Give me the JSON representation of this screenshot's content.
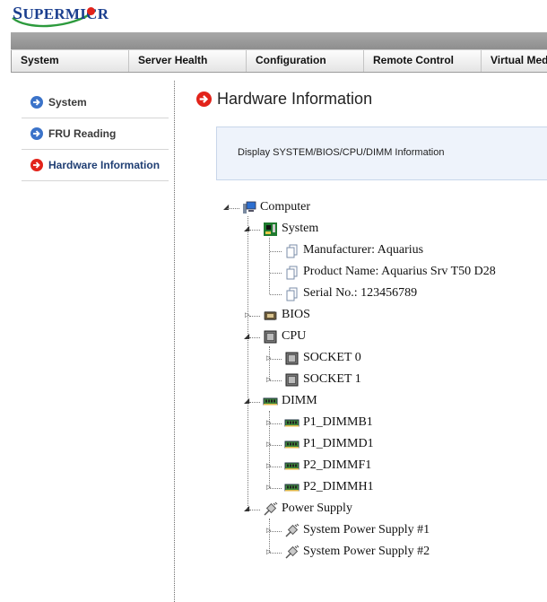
{
  "logo": {
    "text_s": "S",
    "text_rest": "UPERMICR"
  },
  "nav": {
    "tabs": [
      {
        "label": "System",
        "width": 131
      },
      {
        "label": "Server Health",
        "width": 131
      },
      {
        "label": "Configuration",
        "width": 131
      },
      {
        "label": "Remote Control",
        "width": 131
      },
      {
        "label": "Virtual Med",
        "width": 74
      }
    ]
  },
  "sidebar": {
    "items": [
      {
        "label": "System"
      },
      {
        "label": "FRU Reading"
      },
      {
        "label": "Hardware Information"
      }
    ]
  },
  "main": {
    "title": "Hardware Information",
    "description": "Display SYSTEM/BIOS/CPU/DIMM Information"
  },
  "tree": {
    "root": "Computer",
    "system": {
      "label": "System",
      "manufacturer": "Manufacturer: Aquarius",
      "product": "Product Name: Aquarius Srv T50 D28",
      "serial": "Serial No.: 123456789"
    },
    "bios": "BIOS",
    "cpu": {
      "label": "CPU",
      "socket0": "SOCKET 0",
      "socket1": "SOCKET 1"
    },
    "dimm": {
      "label": "DIMM",
      "items": [
        "P1_DIMMB1",
        "P1_DIMMD1",
        "P2_DIMMF1",
        "P2_DIMMH1"
      ]
    },
    "power": {
      "label": "Power Supply",
      "items": [
        "System Power Supply #1",
        "System Power Supply #2"
      ]
    }
  },
  "colors": {
    "accent_blue": "#1b3f8f",
    "active_red": "#e2231a",
    "nav_bar": "#9b9b9b"
  }
}
